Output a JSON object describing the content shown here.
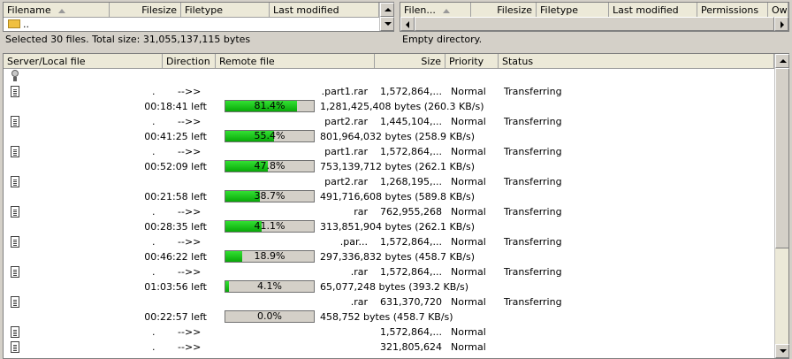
{
  "local_list": {
    "columns": [
      "Filename",
      "Filesize",
      "Filetype",
      "Last modified"
    ],
    "rows": [
      {
        "name": ".."
      }
    ],
    "status": "Selected 30 files. Total size: 31,055,137,115 bytes"
  },
  "remote_list": {
    "columns": [
      "Filen...",
      "Filesize",
      "Filetype",
      "Last modified",
      "Permissions",
      "Owr"
    ],
    "status": "Empty directory."
  },
  "queue": {
    "columns": [
      "Server/Local file",
      "Direction",
      "Remote file",
      "Size",
      "Priority",
      "Status"
    ],
    "items": [
      {
        "dot": ".",
        "direction": "-->>",
        "remote": ".part1.rar",
        "size": "1,572,864,...",
        "priority": "Normal",
        "status": "Transferring",
        "time_left": "00:18:41 left",
        "progress": 81.4,
        "progress_label": "81.4%",
        "bytes": "1,281,425,408 bytes (260.3 KB/s)"
      },
      {
        "dot": ".",
        "direction": "-->>",
        "remote": "part2.rar",
        "size": "1,445,104,...",
        "priority": "Normal",
        "status": "Transferring",
        "time_left": "00:41:25 left",
        "progress": 55.4,
        "progress_label": "55.4%",
        "bytes": "801,964,032 bytes (258.9 KB/s)"
      },
      {
        "dot": ".",
        "direction": "-->>",
        "remote": "part1.rar",
        "size": "1,572,864,...",
        "priority": "Normal",
        "status": "Transferring",
        "time_left": "00:52:09 left",
        "progress": 47.8,
        "progress_label": "47.8%",
        "bytes": "753,139,712 bytes (262.1 KB/s)"
      },
      {
        "dot": "",
        "direction": "",
        "remote": "part2.rar",
        "size": "1,268,195,...",
        "priority": "Normal",
        "status": "Transferring",
        "time_left": "00:21:58 left",
        "progress": 38.7,
        "progress_label": "38.7%",
        "bytes": "491,716,608 bytes (589.8 KB/s)"
      },
      {
        "dot": ".",
        "direction": "-->>",
        "remote": "rar",
        "size": "762,955,268",
        "priority": "Normal",
        "status": "Transferring",
        "time_left": "00:28:35 left",
        "progress": 41.1,
        "progress_label": "41.1%",
        "bytes": "313,851,904 bytes (262.1 KB/s)"
      },
      {
        "dot": ".",
        "direction": "-->>",
        "remote": ".par...",
        "size": "1,572,864,...",
        "priority": "Normal",
        "status": "Transferring",
        "time_left": "00:46:22 left",
        "progress": 18.9,
        "progress_label": "18.9%",
        "bytes": "297,336,832 bytes (458.7 KB/s)"
      },
      {
        "dot": ".",
        "direction": "-->>",
        "remote": ".rar",
        "size": "1,572,864,...",
        "priority": "Normal",
        "status": "Transferring",
        "time_left": "01:03:56 left",
        "progress": 4.1,
        "progress_label": "4.1%",
        "bytes": "65,077,248 bytes (393.2 KB/s)"
      },
      {
        "dot": "",
        "direction": "",
        "remote": ".rar",
        "size": "631,370,720",
        "priority": "Normal",
        "status": "Transferring",
        "time_left": "00:22:57 left",
        "progress": 0.0,
        "progress_label": "0.0%",
        "bytes": "458,752 bytes (458.7 KB/s)"
      }
    ],
    "waiting": [
      {
        "dot": ".",
        "direction": "-->>",
        "size": "1,572,864,...",
        "priority": "Normal"
      },
      {
        "dot": ".",
        "direction": "-->>",
        "size": "321,805,624",
        "priority": "Normal"
      }
    ]
  },
  "colors": {
    "progress_fill": "#22c422",
    "window_bg": "#d4d0c8",
    "header_bg": "#ece9d8"
  }
}
